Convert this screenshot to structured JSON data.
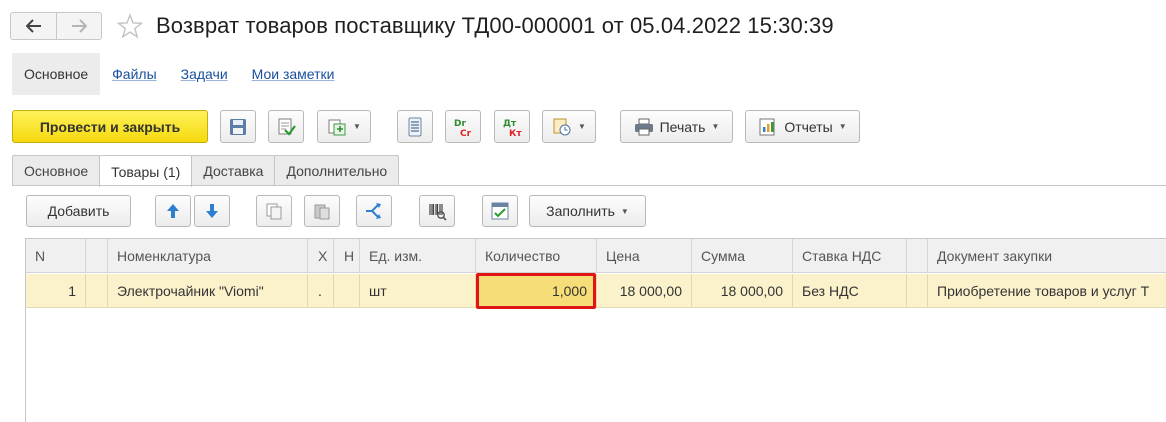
{
  "window": {
    "title": "Возврат товаров поставщику ТД00-000001 от 05.04.2022 15:30:39"
  },
  "section_nav": {
    "items": [
      {
        "label": "Основное",
        "active": true
      },
      {
        "label": "Файлы",
        "active": false
      },
      {
        "label": "Задачи",
        "active": false
      },
      {
        "label": "Мои заметки",
        "active": false
      }
    ]
  },
  "toolbar": {
    "post_close_label": "Провести и закрыть",
    "print_label": "Печать",
    "reports_label": "Отчеты",
    "dt_label": "Дт",
    "kt_label": "Кт"
  },
  "tabs": [
    {
      "label": "Основное",
      "active": false
    },
    {
      "label": "Товары (1)",
      "active": true
    },
    {
      "label": "Доставка",
      "active": false
    },
    {
      "label": "Дополнительно",
      "active": false
    }
  ],
  "table_toolbar": {
    "add_label": "Добавить",
    "fill_label": "Заполнить"
  },
  "table": {
    "headers": {
      "n": "N",
      "nomenclature": "Номенклатура",
      "char": "Х",
      "h": "Н",
      "unit": "Ед. изм.",
      "quantity": "Количество",
      "price": "Цена",
      "sum": "Сумма",
      "vat_rate": "Ставка НДС",
      "purchase_doc": "Документ закупки"
    },
    "rows": [
      {
        "n": "1",
        "nomenclature": "Электрочайник \"Viomi\"",
        "char": ".",
        "h": "",
        "unit": "шт",
        "quantity": "1,000",
        "price": "18 000,00",
        "sum": "18 000,00",
        "vat_rate": "Без НДС",
        "purchase_doc": "Приобретение товаров и услуг Т"
      }
    ]
  },
  "colors": {
    "primary_button": "#f5d90d",
    "selected_row": "#fbf2cc",
    "highlight_border": "#e01515",
    "link": "#1a4f9c"
  }
}
